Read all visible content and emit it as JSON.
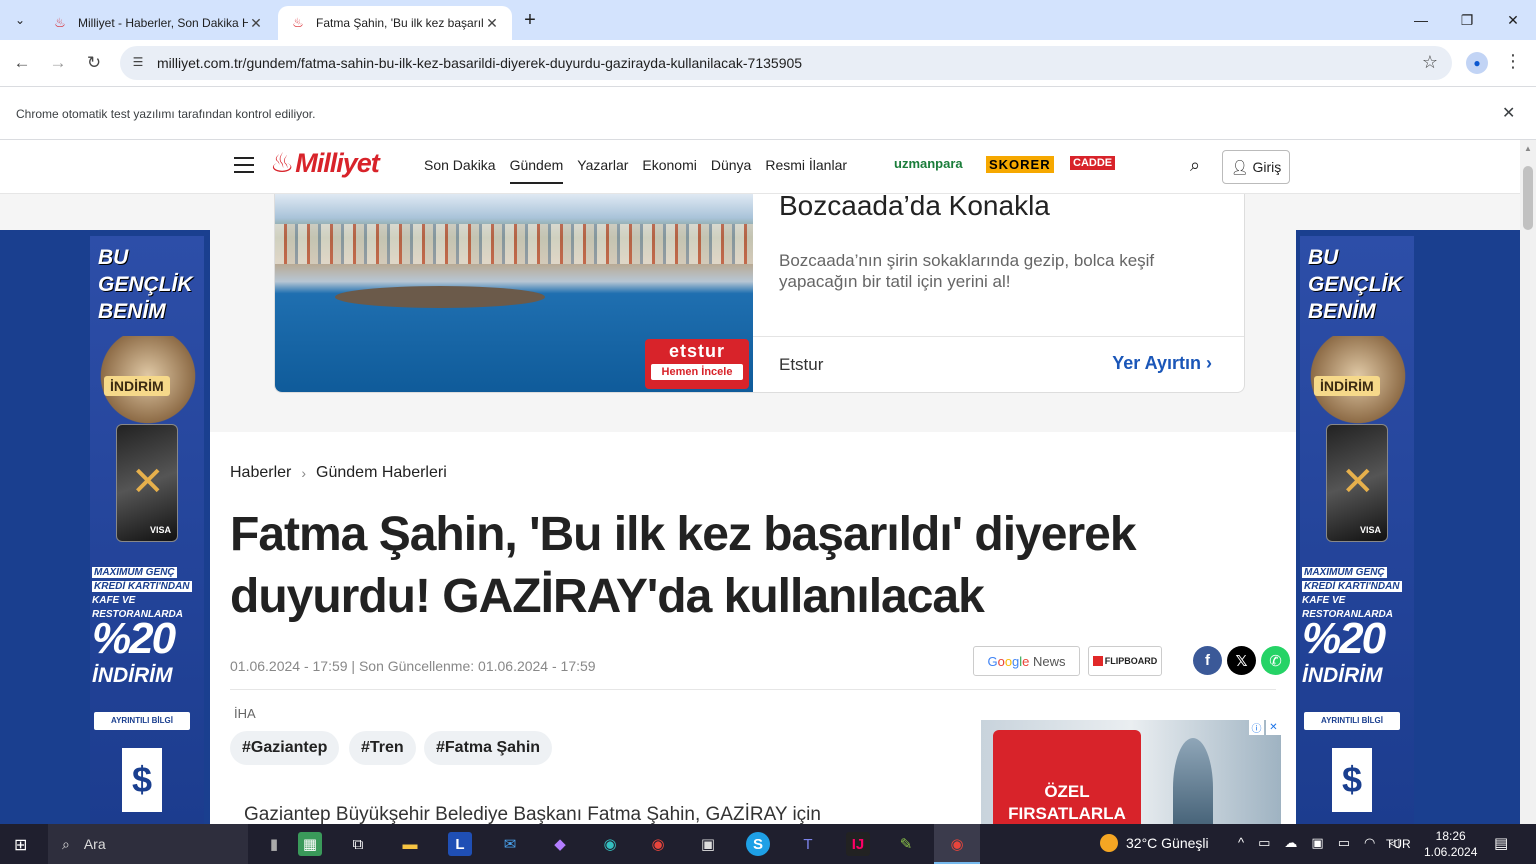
{
  "browser": {
    "tabs": [
      {
        "title": "Milliyet - Haberler, Son Dakika Haberleri ve Güncel Haber",
        "active": false
      },
      {
        "title": "Fatma Şahin, 'Bu ilk kez başarıldı' diyerek duyurdu! GAZİRAY'da kullanılacak",
        "active": true
      }
    ],
    "url": "milliyet.com.tr/gundem/fatma-sahin-bu-ilk-kez-basarildi-diyerek-duyurdu-gazirayda-kullanilacak-7135905",
    "infobar": "Chrome otomatik test yazılımı tarafından kontrol ediliyor."
  },
  "site": {
    "logo": "Milliyet",
    "nav": [
      "Son Dakika",
      "Gündem",
      "Yazarlar",
      "Ekonomi",
      "Dünya",
      "Resmi İlanlar"
    ],
    "active_nav": "Gündem",
    "partners": [
      "uzmanpara",
      "SKORER",
      "CADDE"
    ],
    "login": "Giriş"
  },
  "top_ad": {
    "title": "Bozcaada’da Konakla",
    "description": "Bozcaada’nın şirin sokaklarında gezip, bolca keşif yapacağın bir tatil için yerini al!",
    "brand": "Etstur",
    "cta": "Yer Ayırtın",
    "badge_logo": "etstur",
    "badge_button": "Hemen İncele"
  },
  "side_banner": {
    "headline": [
      "BU",
      "GENÇLİK",
      "BENİM"
    ],
    "indirim_tag": "İNDİRİM",
    "card_brand": "VISA",
    "sub_lines": [
      "MAXIMUM GENÇ",
      "KREDİ KARTI'NDAN",
      "KAFE VE",
      "RESTORANLARDA"
    ],
    "percent": "%20",
    "percent_label": "İNDİRİM",
    "button": "AYRINTILI BİLGİ",
    "bank_logo": "İş"
  },
  "article": {
    "breadcrumb": [
      "Haberler",
      "Gündem Haberleri"
    ],
    "headline": "Fatma Şahin, 'Bu ilk kez başarıldı' diyerek duyurdu! GAZİRAY'da kullanılacak",
    "meta": "01.06.2024 - 17:59 | Son Güncellenme: 01.06.2024 - 17:59",
    "source": "İHA",
    "tags": [
      "#Gaziantep",
      "#Tren",
      "#Fatma Şahin"
    ],
    "body_start": "Gaziantep Büyükşehir Belediye Başkanı Fatma Şahin, GAZİRAY için",
    "share": {
      "google_news": "Google News",
      "flipboard": "FLIPBOARD"
    }
  },
  "side_ad": {
    "line1": "ÖZEL",
    "line2": "FIRSATLARLA"
  },
  "taskbar": {
    "search": "Ara",
    "weather": "32°C  Güneşli",
    "lang": "TUR",
    "time": "18:26",
    "date": "1.06.2024"
  }
}
